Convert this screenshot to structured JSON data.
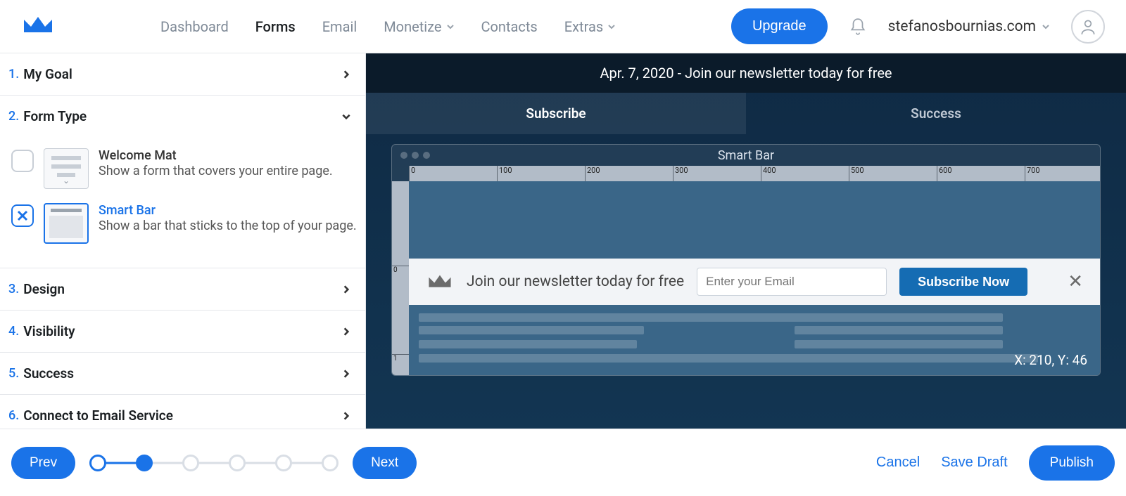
{
  "nav": {
    "items": [
      "Dashboard",
      "Forms",
      "Email",
      "Monetize",
      "Contacts",
      "Extras"
    ],
    "activeIndex": 1,
    "upgrade": "Upgrade",
    "user": "stefanosbournias.com"
  },
  "sidebar": {
    "steps": [
      {
        "num": "1.",
        "label": "My Goal"
      },
      {
        "num": "2.",
        "label": "Form Type"
      },
      {
        "num": "3.",
        "label": "Design"
      },
      {
        "num": "4.",
        "label": "Visibility"
      },
      {
        "num": "5.",
        "label": "Success"
      },
      {
        "num": "6.",
        "label": "Connect to Email Service"
      }
    ],
    "formTypes": [
      {
        "title": "Welcome Mat",
        "desc": "Show a form that covers your entire page."
      },
      {
        "title": "Smart Bar",
        "desc": "Show a bar that sticks to the top of your page."
      }
    ],
    "selectedFormType": 1
  },
  "preview": {
    "header": "Apr. 7, 2020 - Join our newsletter today for free",
    "tabs": [
      "Subscribe",
      "Success"
    ],
    "activeTab": 0,
    "windowTitle": "Smart Bar",
    "barMessage": "Join our newsletter today for free",
    "emailPlaceholder": "Enter your Email",
    "subscribeLabel": "Subscribe Now",
    "coords": "X: 210, Y: 46",
    "rulerMarks": [
      "0",
      "100",
      "200",
      "300",
      "400",
      "500",
      "600",
      "700"
    ],
    "rulerV": [
      "0",
      "1"
    ]
  },
  "bottom": {
    "prev": "Prev",
    "next": "Next",
    "cancel": "Cancel",
    "saveDraft": "Save Draft",
    "publish": "Publish"
  }
}
